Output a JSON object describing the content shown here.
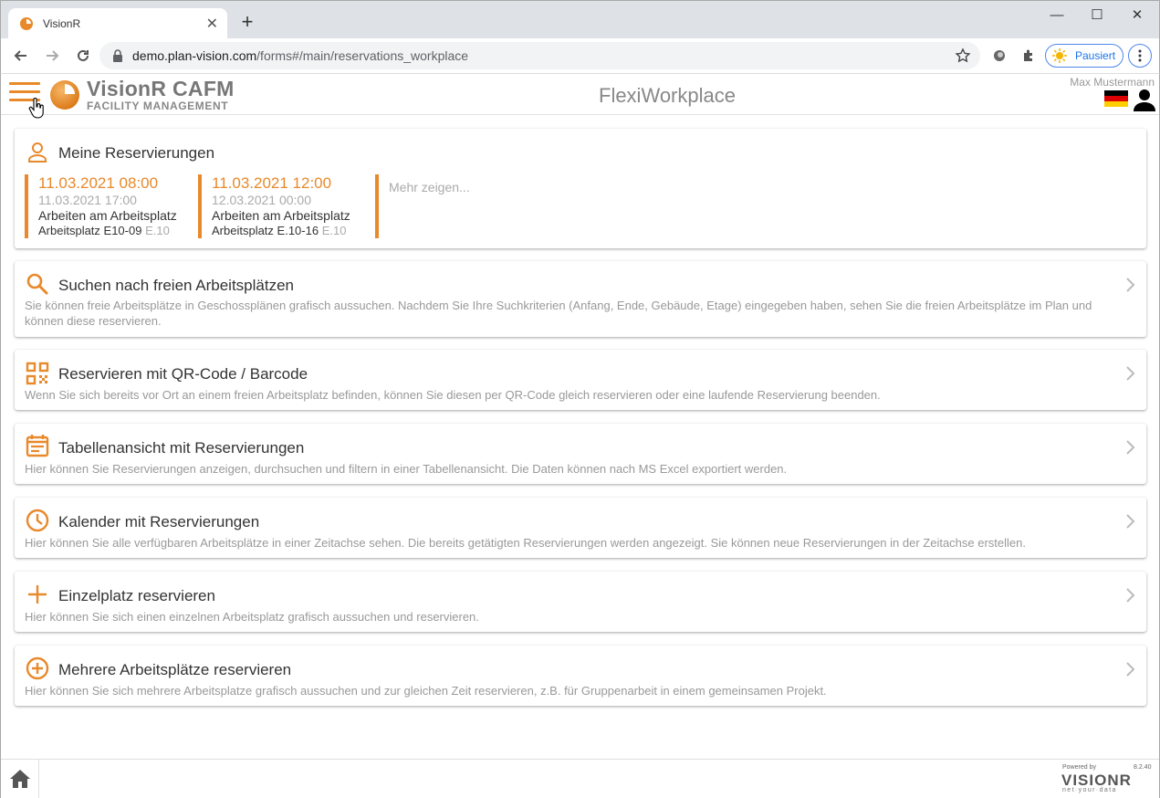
{
  "browser": {
    "tab_title": "VisionR",
    "url_host": "demo.plan-vision.com",
    "url_path": "/forms#/main/reservations_workplace",
    "profile_label": "Pausiert"
  },
  "app": {
    "brand_title": "VisionR CAFM",
    "brand_subtitle": "FACILITY MANAGEMENT",
    "page_title": "FlexiWorkplace",
    "user_name": "Max Mustermann"
  },
  "reservations": {
    "title": "Meine Reservierungen",
    "items": [
      {
        "start": "11.03.2021 08:00",
        "end": "11.03.2021 17:00",
        "type": "Arbeiten am Arbeitsplatz",
        "place": "Arbeitsplatz E10-09",
        "floor": "E.10"
      },
      {
        "start": "11.03.2021 12:00",
        "end": "12.03.2021 00:00",
        "type": "Arbeiten am Arbeitsplatz",
        "place": "Arbeitsplatz E.10-16",
        "floor": "E.10"
      }
    ],
    "more": "Mehr zeigen..."
  },
  "cards": [
    {
      "icon": "search-icon",
      "title": "Suchen nach freien Arbeitsplätzen",
      "desc": "Sie können freie Arbeitsplätze in Geschossplänen grafisch aussuchen. Nachdem Sie Ihre Suchkriterien (Anfang, Ende, Gebäude, Etage) eingegeben haben, sehen Sie die freien Arbeitsplätze im Plan und können diese reservieren."
    },
    {
      "icon": "qr-code-icon",
      "title": "Reservieren mit QR-Code / Barcode",
      "desc": "Wenn Sie sich bereits vor Ort an einem freien Arbeitsplatz befinden, können Sie diesen per QR-Code gleich reservieren oder eine laufende Reservierung beenden."
    },
    {
      "icon": "calendar-icon",
      "title": "Tabellenansicht mit Reservierungen",
      "desc": "Hier können Sie Reservierungen anzeigen, durchsuchen und filtern in einer Tabellenansicht. Die Daten können nach MS Excel exportiert werden."
    },
    {
      "icon": "clock-icon",
      "title": "Kalender mit Reservierungen",
      "desc": "Hier können Sie alle verfügbaren Arbeitsplätze in einer Zeitachse sehen. Die bereits getätigten Reservierungen werden angezeigt. Sie können neue Reservierungen in der Zeitachse erstellen."
    },
    {
      "icon": "plus-icon",
      "title": "Einzelplatz reservieren",
      "desc": "Hier können Sie sich einen einzelnen Arbeitsplatz grafisch aussuchen und reservieren."
    },
    {
      "icon": "add-circle-icon",
      "title": "Mehrere Arbeitsplätze reservieren",
      "desc": "Hier können Sie sich mehrere Arbeitsplatze grafisch aussuchen und zur gleichen Zeit reservieren, z.B. für Gruppenarbeit in einem gemeinsamen Projekt."
    }
  ],
  "footer": {
    "powered": "Powered by",
    "version": "8.2.40",
    "logo_text": "VISIONR",
    "logo_tag": "net·your·data"
  },
  "colors": {
    "accent": "#e8892b"
  }
}
